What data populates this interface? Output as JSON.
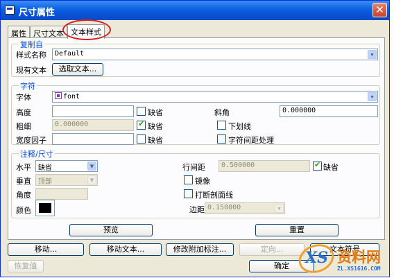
{
  "window": {
    "title": "尺寸属性",
    "close": "✕"
  },
  "tabs": [
    "属性",
    "尺寸文本",
    "文本样式"
  ],
  "copy_from": {
    "legend": "复制自",
    "style_name_label": "样式名称",
    "style_name_value": "Default",
    "existing_text_label": "现有文本",
    "select_text_button": "选取文本..."
  },
  "character": {
    "legend": "字符",
    "font_label": "字体",
    "font_value": "font",
    "height_label": "高度",
    "height_value": "",
    "height_default_label": "缺省",
    "height_default_checked": false,
    "slant_label": "斜角",
    "slant_value": "0.000000",
    "thickness_label": "粗细",
    "thickness_value": "0.000000",
    "thickness_default_label": "缺省",
    "thickness_default_checked": true,
    "underline_label": "下划线",
    "underline_checked": false,
    "width_factor_label": "宽度因子",
    "width_factor_value": "",
    "width_default_label": "缺省",
    "width_default_checked": false,
    "kerning_label": "字符间距处理",
    "kerning_checked": false
  },
  "note": {
    "legend": "注释/尺寸",
    "horizontal_label": "水平",
    "horizontal_value": "缺省",
    "vertical_label": "垂直",
    "vertical_value": "顶部",
    "angle_label": "角度",
    "angle_value": "",
    "color_label": "颜色",
    "color_value": "#000000",
    "line_spacing_label": "行间距",
    "line_spacing_value": "0.500000",
    "line_spacing_default_label": "缺省",
    "line_spacing_default_checked": true,
    "mirror_label": "镜像",
    "mirror_checked": false,
    "break_hatch_label": "打断剖面线",
    "break_hatch_checked": false,
    "margin_label": "边距",
    "margin_value": "0.150000"
  },
  "panel_buttons": {
    "preview": "预览",
    "reset": "重置"
  },
  "bottom_buttons": {
    "move": "移动...",
    "move_text": "移动文本...",
    "modify_attached_note": "修改附加标注...",
    "orient": "定向...",
    "text_symbol": "文本符号",
    "restore": "恢复值",
    "ok": "确定"
  },
  "watermark": {
    "brand": "资料网",
    "url": "ZL.XS1616.COM"
  }
}
